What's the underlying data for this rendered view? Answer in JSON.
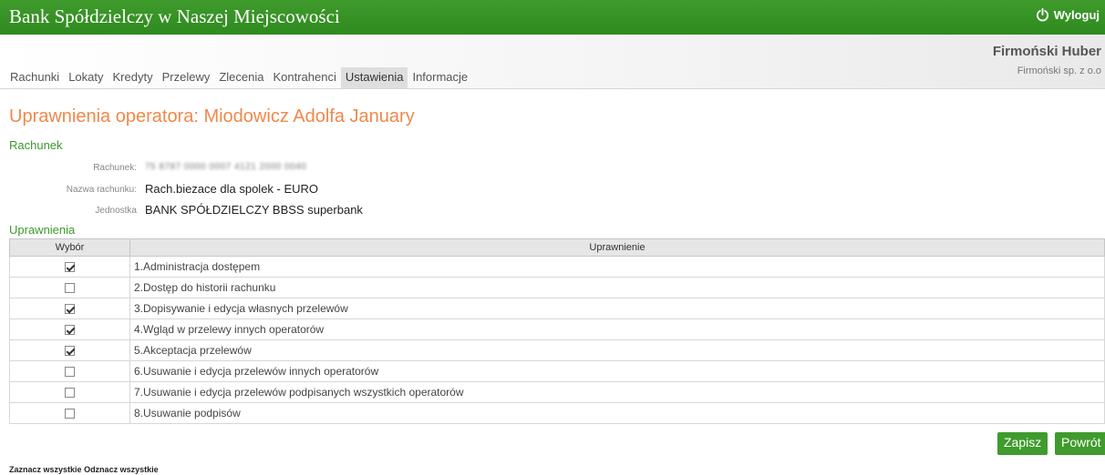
{
  "header": {
    "bank_name": "Bank Spółdzielczy w Naszej Miejscowości",
    "logout_label": "Wyloguj"
  },
  "nav": {
    "tabs": [
      {
        "label": "Rachunki"
      },
      {
        "label": "Lokaty"
      },
      {
        "label": "Kredyty"
      },
      {
        "label": "Przelewy"
      },
      {
        "label": "Zlecenia"
      },
      {
        "label": "Kontrahenci"
      },
      {
        "label": "Ustawienia",
        "active": true
      },
      {
        "label": "Informacje"
      }
    ],
    "user_name": "Firmoński Huber",
    "user_company": "Firmoński sp. z o.o"
  },
  "page": {
    "title": "Uprawnienia operatora: Miodowicz Adolfa January"
  },
  "account": {
    "section_label": "Rachunek",
    "account_label": "Rachunek:",
    "account_value": "75 8787 0000 0007 4121 2000 0040",
    "name_label": "Nazwa rachunku:",
    "name_value": "Rach.biezace dla spolek - EURO",
    "unit_label": "Jednostka",
    "unit_value": "BANK SPÓŁDZIELCZY BBSS superbank"
  },
  "permissions": {
    "section_label": "Uprawnienia",
    "col_choice": "Wybór",
    "col_permission": "Uprawnienie",
    "rows": [
      {
        "label": "1.Administracja dostępem",
        "checked": true
      },
      {
        "label": "2.Dostęp do historii rachunku",
        "checked": false
      },
      {
        "label": "3.Dopisywanie i edycja własnych przelewów",
        "checked": true
      },
      {
        "label": "4.Wgląd w przelewy innych operatorów",
        "checked": true
      },
      {
        "label": "5.Akceptacja przelewów",
        "checked": true
      },
      {
        "label": "6.Usuwanie i edycja przelewów innych operatorów",
        "checked": false
      },
      {
        "label": "7.Usuwanie i edycja przelewów podpisanych wszystkich operatorów",
        "checked": false
      },
      {
        "label": "8.Usuwanie podpisów",
        "checked": false
      }
    ]
  },
  "actions": {
    "save_label": "Zapisz",
    "back_label": "Powrót",
    "select_all_label": "Zaznacz wszystkie",
    "deselect_all_label": "Odznacz wszystkie"
  },
  "colors": {
    "brand_green": "#3f9b2c",
    "title_orange": "#f0884a"
  }
}
